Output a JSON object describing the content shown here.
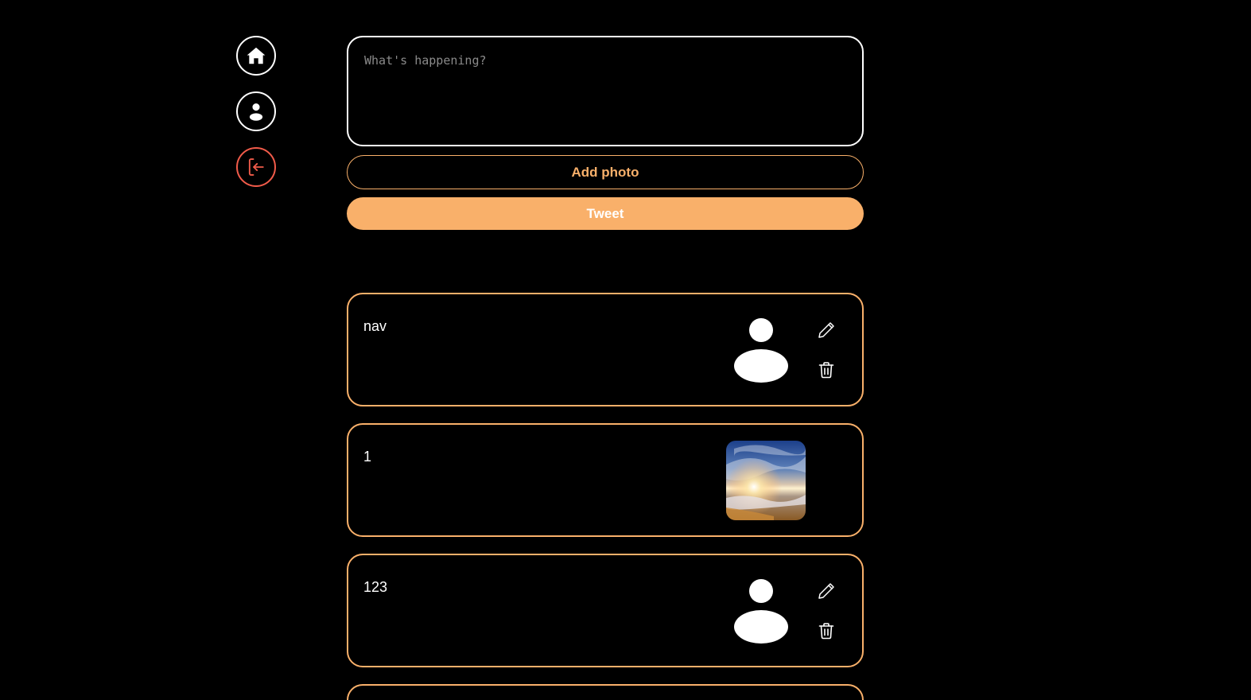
{
  "nav": {
    "items": [
      {
        "name": "home",
        "icon": "home-icon"
      },
      {
        "name": "profile",
        "icon": "user-icon"
      },
      {
        "name": "logout",
        "icon": "logout-icon"
      }
    ]
  },
  "compose": {
    "placeholder": "What's happening?",
    "add_photo_label": "Add photo",
    "tweet_label": "Tweet"
  },
  "tweets": [
    {
      "text": "nav",
      "media": "avatar-icon",
      "editable": true
    },
    {
      "text": "1",
      "media": "photo",
      "editable": false
    },
    {
      "text": "123",
      "media": "avatar-icon",
      "editable": true
    }
  ],
  "colors": {
    "background": "#000000",
    "accent": "#f9b06a",
    "logout": "#f15b4a",
    "text": "#ffffff",
    "placeholder": "#8a8a8a"
  }
}
